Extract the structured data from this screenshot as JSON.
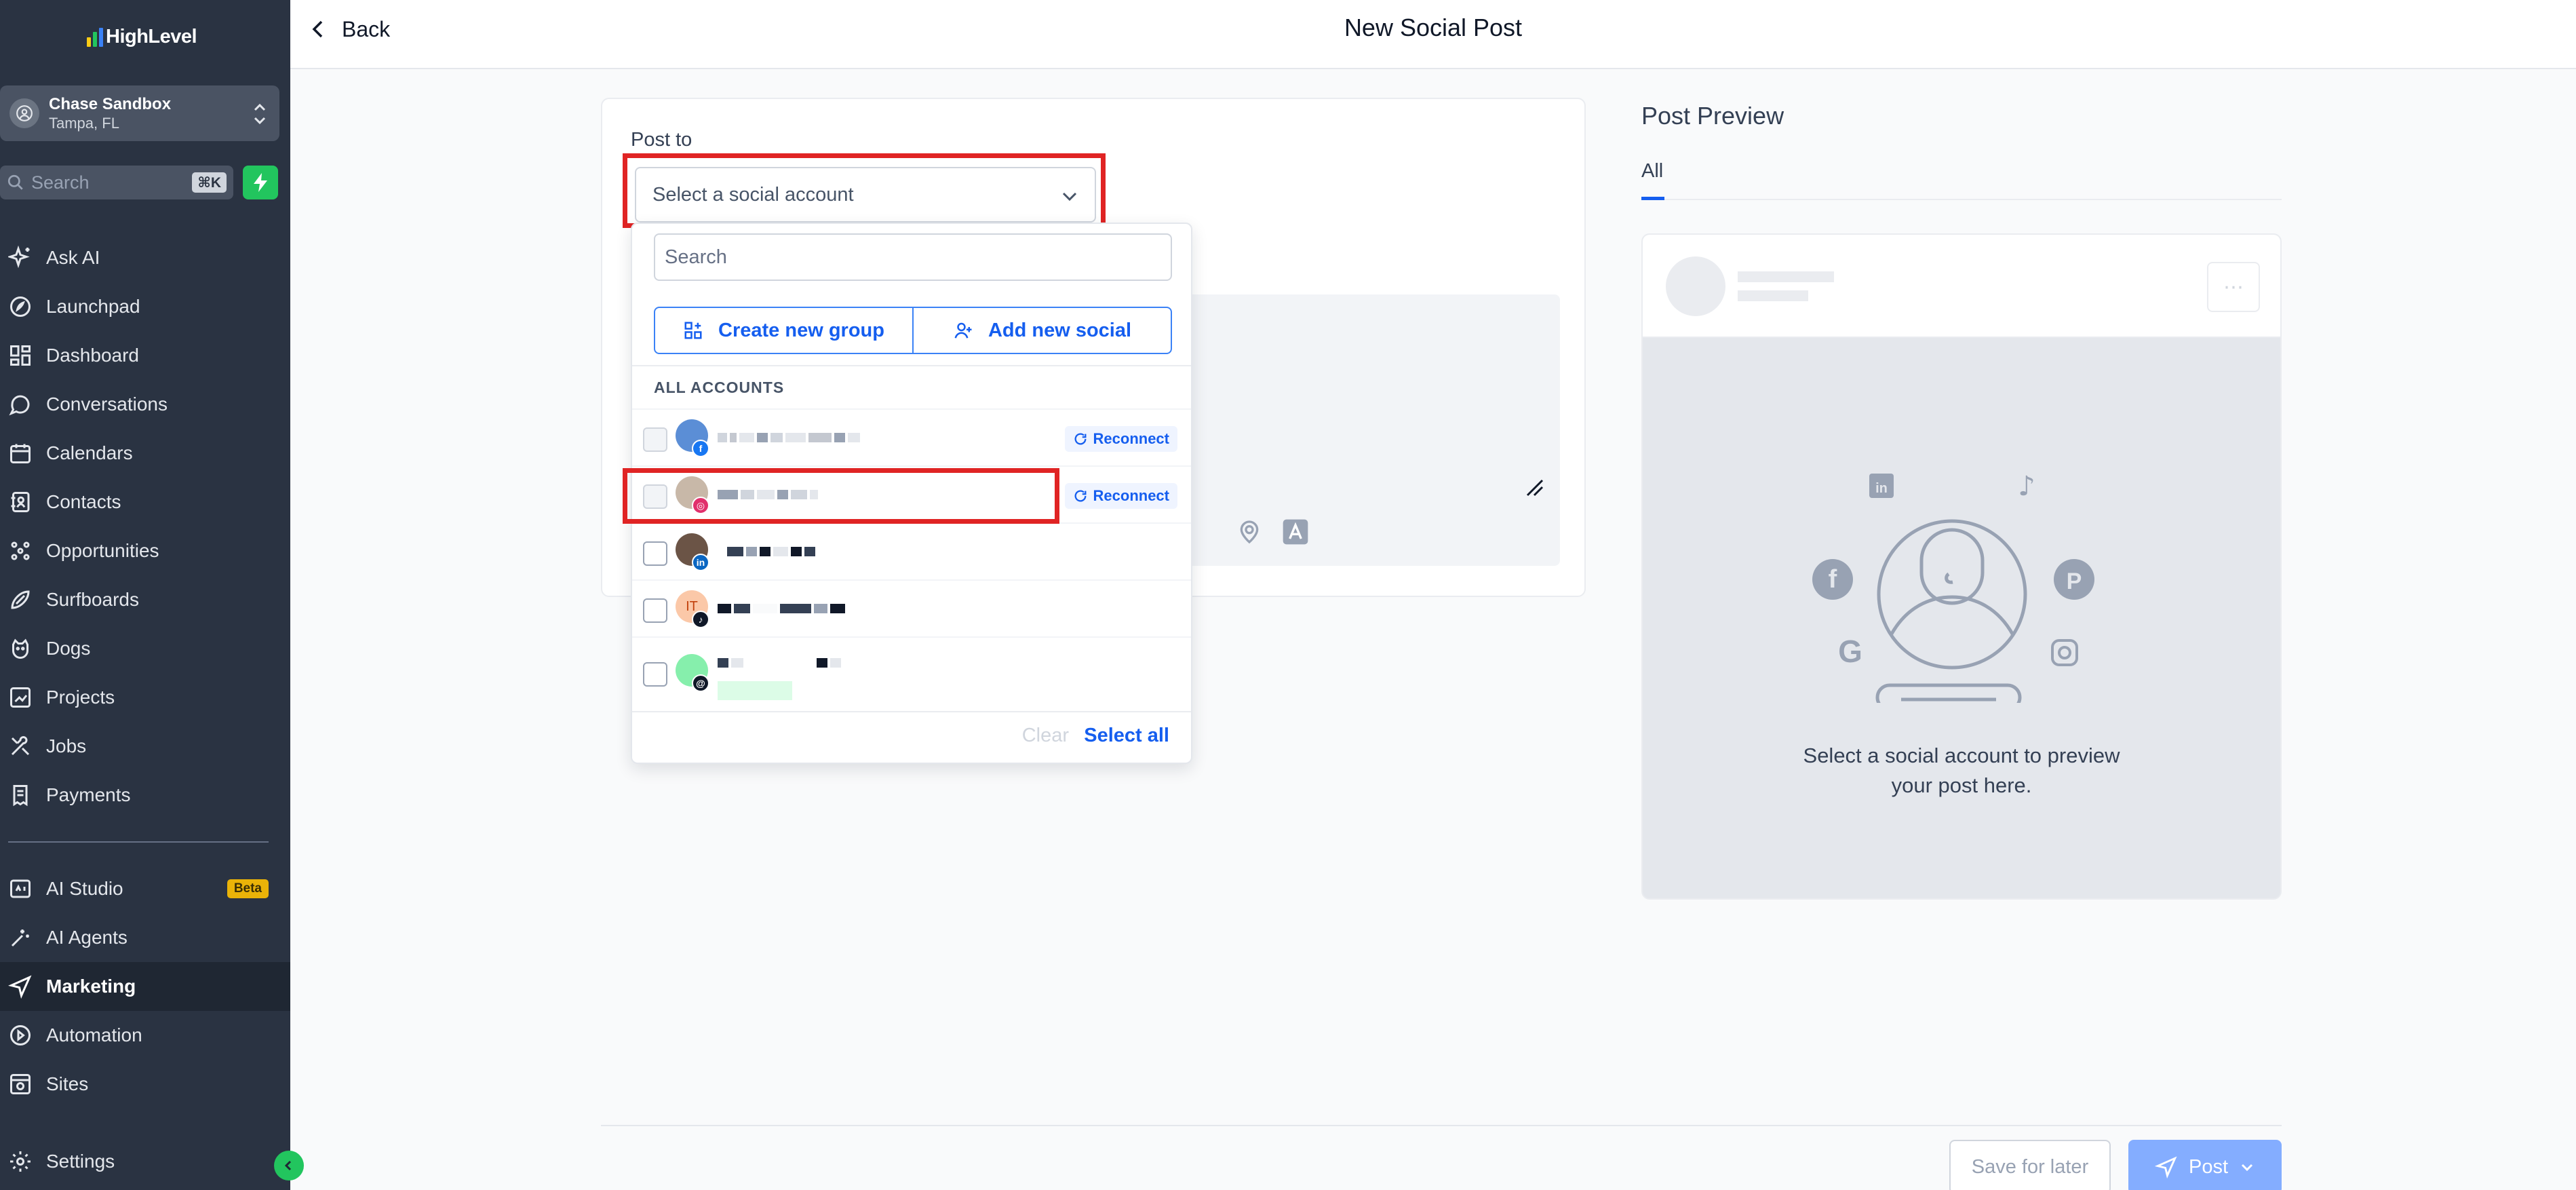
{
  "app": {
    "logo_text": "HighLevel",
    "account_name": "Chase Sandbox",
    "account_location": "Tampa, FL",
    "search_placeholder": "Search",
    "search_shortcut": "⌘K"
  },
  "sidebar": {
    "items": [
      {
        "label": "Ask AI",
        "icon": "sparkle-icon"
      },
      {
        "label": "Launchpad",
        "icon": "rocket-icon"
      },
      {
        "label": "Dashboard",
        "icon": "dashboard-icon"
      },
      {
        "label": "Conversations",
        "icon": "chat-icon"
      },
      {
        "label": "Calendars",
        "icon": "calendar-icon"
      },
      {
        "label": "Contacts",
        "icon": "contacts-icon"
      },
      {
        "label": "Opportunities",
        "icon": "opportunities-icon"
      },
      {
        "label": "Surfboards",
        "icon": "surfboard-icon"
      },
      {
        "label": "Dogs",
        "icon": "dog-icon"
      },
      {
        "label": "Projects",
        "icon": "projects-icon"
      },
      {
        "label": "Jobs",
        "icon": "jobs-icon"
      },
      {
        "label": "Payments",
        "icon": "payments-icon"
      },
      {
        "label": "AI Studio",
        "icon": "ai-studio-icon",
        "badge": "Beta"
      },
      {
        "label": "AI Agents",
        "icon": "ai-agents-icon"
      },
      {
        "label": "Marketing",
        "icon": "send-icon",
        "active": true
      },
      {
        "label": "Automation",
        "icon": "automation-icon"
      },
      {
        "label": "Sites",
        "icon": "sites-icon"
      },
      {
        "label": "Settings",
        "icon": "gear-icon"
      }
    ]
  },
  "header": {
    "back_label": "Back",
    "title": "New Social Post"
  },
  "editor": {
    "post_to_label": "Post to",
    "select_placeholder": "Select a social account"
  },
  "dropdown": {
    "search_placeholder": "Search",
    "create_group_label": "Create new group",
    "add_social_label": "Add new social",
    "section_label": "ALL ACCOUNTS",
    "reconnect_label": "Reconnect",
    "avatar_initials": "IT",
    "accounts": [
      {
        "platform": "facebook",
        "needs_reconnect": true
      },
      {
        "platform": "instagram",
        "needs_reconnect": true
      },
      {
        "platform": "linkedin",
        "needs_reconnect": false
      },
      {
        "platform": "tiktok",
        "needs_reconnect": false
      },
      {
        "platform": "threads",
        "needs_reconnect": false
      }
    ],
    "clear_label": "Clear",
    "select_all_label": "Select all"
  },
  "preview": {
    "title": "Post Preview",
    "tab_all": "All",
    "message_line1": "Select a social account to preview",
    "message_line2": "your post here."
  },
  "footer": {
    "save_later_label": "Save for later",
    "post_label": "Post"
  },
  "colors": {
    "sidebar_bg": "#2a3342",
    "accent_blue": "#155eef",
    "highlight_red": "#e02424",
    "bolt_green": "#22c55e"
  }
}
